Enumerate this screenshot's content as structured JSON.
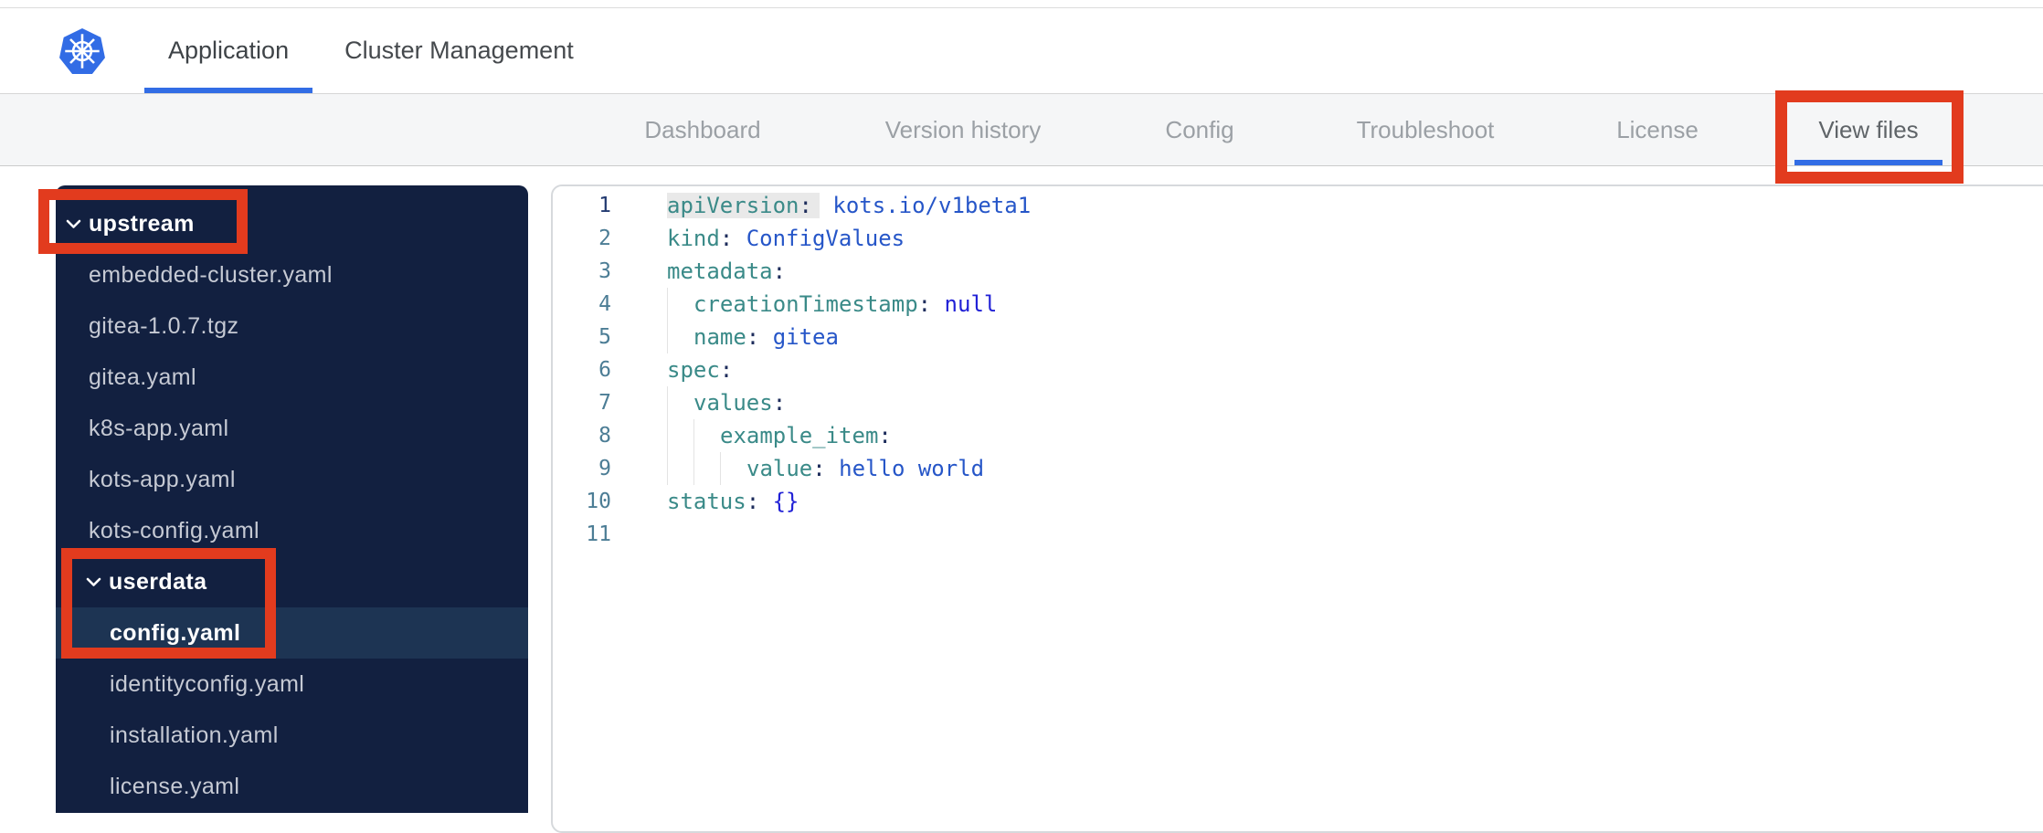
{
  "header": {
    "tabs": [
      {
        "label": "Application",
        "active": true
      },
      {
        "label": "Cluster Management",
        "active": false
      }
    ]
  },
  "subnav": {
    "tabs": [
      {
        "label": "Dashboard"
      },
      {
        "label": "Version history"
      },
      {
        "label": "Config"
      },
      {
        "label": "Troubleshoot"
      },
      {
        "label": "License"
      },
      {
        "label": "View files",
        "active": true
      }
    ]
  },
  "sidebar": {
    "items": [
      {
        "label": "upstream",
        "type": "folder",
        "depth": 0,
        "expanded": true
      },
      {
        "label": "embedded-cluster.yaml",
        "type": "file",
        "depth": 1
      },
      {
        "label": "gitea-1.0.7.tgz",
        "type": "file",
        "depth": 1
      },
      {
        "label": "gitea.yaml",
        "type": "file",
        "depth": 1
      },
      {
        "label": "k8s-app.yaml",
        "type": "file",
        "depth": 1
      },
      {
        "label": "kots-app.yaml",
        "type": "file",
        "depth": 1
      },
      {
        "label": "kots-config.yaml",
        "type": "file",
        "depth": 1
      },
      {
        "label": "userdata",
        "type": "folder",
        "depth": 1,
        "expanded": true
      },
      {
        "label": "config.yaml",
        "type": "file",
        "depth": 2,
        "selected": true
      },
      {
        "label": "identityconfig.yaml",
        "type": "file",
        "depth": 2
      },
      {
        "label": "installation.yaml",
        "type": "file",
        "depth": 2
      },
      {
        "label": "license.yaml",
        "type": "file",
        "depth": 2
      }
    ]
  },
  "editor": {
    "lines": [
      {
        "num": "1",
        "key": "apiVersion",
        "colon": ":",
        "value": " kots.io/v1beta1"
      },
      {
        "num": "2",
        "key": "kind",
        "colon": ":",
        "value": " ConfigValues"
      },
      {
        "num": "3",
        "key": "metadata",
        "colon": ":",
        "value": ""
      },
      {
        "num": "4",
        "key": "creationTimestamp",
        "colon": ":",
        "value": " null"
      },
      {
        "num": "5",
        "key": "name",
        "colon": ":",
        "value": " gitea"
      },
      {
        "num": "6",
        "key": "spec",
        "colon": ":",
        "value": ""
      },
      {
        "num": "7",
        "key": "values",
        "colon": ":",
        "value": ""
      },
      {
        "num": "8",
        "key": "example_item",
        "colon": ":",
        "value": ""
      },
      {
        "num": "9",
        "key": "value",
        "colon": ":",
        "value": " hello world"
      },
      {
        "num": "10",
        "key": "status",
        "colon": ":",
        "value": " {}"
      },
      {
        "num": "11",
        "key": "",
        "colon": "",
        "value": ""
      }
    ]
  },
  "icons": {
    "logo": "kubernetes-helm-logo",
    "folder_chevron": "chevron-down"
  },
  "colors": {
    "accent_blue": "#326de5",
    "annotation_red": "#e23b1e",
    "sidebar_bg": "#122040",
    "sidebar_selected_bg": "#1d3453",
    "subnav_bg": "#f5f6f7",
    "yaml_key": "#3a8a88",
    "yaml_value": "#2656c8",
    "yaml_constant": "#2121d6",
    "gutter_number": "#4c7d95",
    "gutter_number_active": "#223a70"
  }
}
